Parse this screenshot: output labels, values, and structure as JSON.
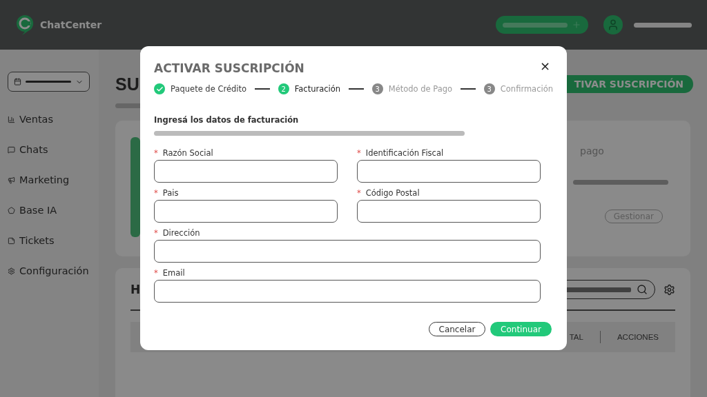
{
  "header": {
    "logo_text": "ChatCenter"
  },
  "sidebar": {
    "items": [
      {
        "label": "Ventas"
      },
      {
        "label": "Chats"
      },
      {
        "label": "Marketing"
      },
      {
        "label": "Base IA"
      },
      {
        "label": "Tickets"
      },
      {
        "label": "Configuración"
      }
    ]
  },
  "background": {
    "page_title": "SU",
    "primary_button": "TIVAR SUSCRIPCIÓN",
    "card_text": "pago",
    "manage_button": "Gestionar",
    "section_title": "H",
    "table_columns": [
      "TAL",
      "ACCIONES"
    ]
  },
  "modal": {
    "title": "ACTIVAR SUSCRIPCIÓN",
    "close": "×",
    "steps": [
      {
        "label": "Paquete de Crédito",
        "completed": true,
        "selected": false
      },
      {
        "label": "Facturación",
        "number": "2",
        "completed": false,
        "selected": true
      },
      {
        "label": "Método de Pago",
        "number": "3",
        "completed": false,
        "selected": false
      },
      {
        "label": "Confirmación",
        "number": "3",
        "completed": false,
        "selected": false
      }
    ],
    "subtitle": "Ingresá los datos de facturación",
    "fields": [
      {
        "label": "Razón Social",
        "required_mark": "*",
        "kind": "half"
      },
      {
        "label": "Identificación Fiscal",
        "required_mark": "*",
        "kind": "half"
      },
      {
        "label": "Pais",
        "required_mark": "*",
        "kind": "half"
      },
      {
        "label": "Código Postal",
        "required_mark": "*",
        "kind": "half"
      },
      {
        "label": "Dirección",
        "required_mark": "*",
        "kind": "full"
      },
      {
        "label": "Email",
        "required_mark": "*",
        "kind": "full"
      }
    ],
    "buttons": {
      "cancel": "Cancelar",
      "continue": "Continuar"
    }
  }
}
